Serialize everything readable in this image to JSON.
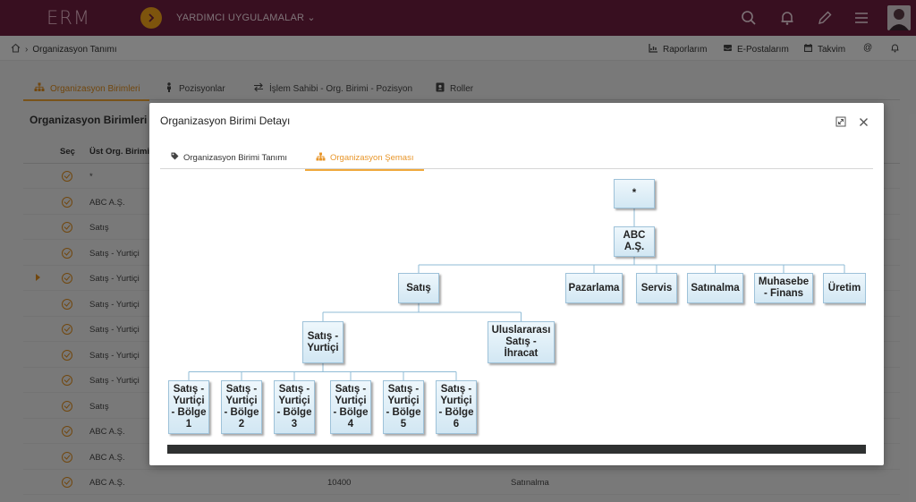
{
  "app": {
    "logo": "ERM",
    "apps_label": "YARDIMCI UYGULAMALAR"
  },
  "breadcrumb": {
    "page": "Organizasyon Tanımı"
  },
  "shortcuts": {
    "reports": "Raporlarım",
    "emails": "E-Postalarım",
    "calendar": "Takvim",
    "at": "@"
  },
  "page_tabs": [
    "Organizasyon Birimleri",
    "Pozisyonlar",
    "İşlem Sahibi - Org. Birimi - Pozisyon",
    "Roller"
  ],
  "section": {
    "title": "Organizasyon Birimleri"
  },
  "grid": {
    "columns": {
      "select": "Seç",
      "parent": "Üst Org. Birimi"
    },
    "rows": [
      {
        "parent": "*"
      },
      {
        "parent": "ABC A.Ş."
      },
      {
        "parent": "Satış"
      },
      {
        "parent": "Satış - Yurtiçi"
      },
      {
        "parent": "Satış - Yurtiçi"
      },
      {
        "parent": "Satış - Yurtiçi"
      },
      {
        "parent": "Satış - Yurtiçi"
      },
      {
        "parent": "Satış - Yurtiçi"
      },
      {
        "parent": "Satış - Yurtiçi"
      },
      {
        "parent": "Satış"
      },
      {
        "parent": "ABC A.Ş."
      },
      {
        "parent": "ABC A.Ş."
      },
      {
        "parent": "ABC A.Ş.",
        "code": "10400",
        "name": "Satınalma"
      }
    ]
  },
  "modal": {
    "title": "Organizasyon Birimi Detayı",
    "tabs": [
      "Organizasyon Birimi Tanımı",
      "Organizasyon Şeması"
    ],
    "active_tab": "Organizasyon Şeması"
  },
  "org_chart": {
    "root": "*",
    "company": "ABC A.Ş.",
    "level2": [
      "Satış",
      "Pazarlama",
      "Servis",
      "Satınalma",
      "Muhasebe - Finans",
      "Üretim"
    ],
    "sales_children": [
      "Satış - Yurtiçi",
      "Uluslararası Satış - İhracat"
    ],
    "regions": [
      "Satış - Yurtiçi - Bölge 1",
      "Satış - Yurtiçi - Bölge 2",
      "Satış - Yurtiçi - Bölge 3",
      "Satış - Yurtiçi - Bölge 4",
      "Satış - Yurtiçi - Bölge 5",
      "Satış - Yurtiçi - Bölge 6"
    ]
  },
  "colors": {
    "topbar": "#6b1d3e",
    "accent": "#e8962a",
    "node_border": "#9ec2d9",
    "connector": "#8fbbd6"
  }
}
